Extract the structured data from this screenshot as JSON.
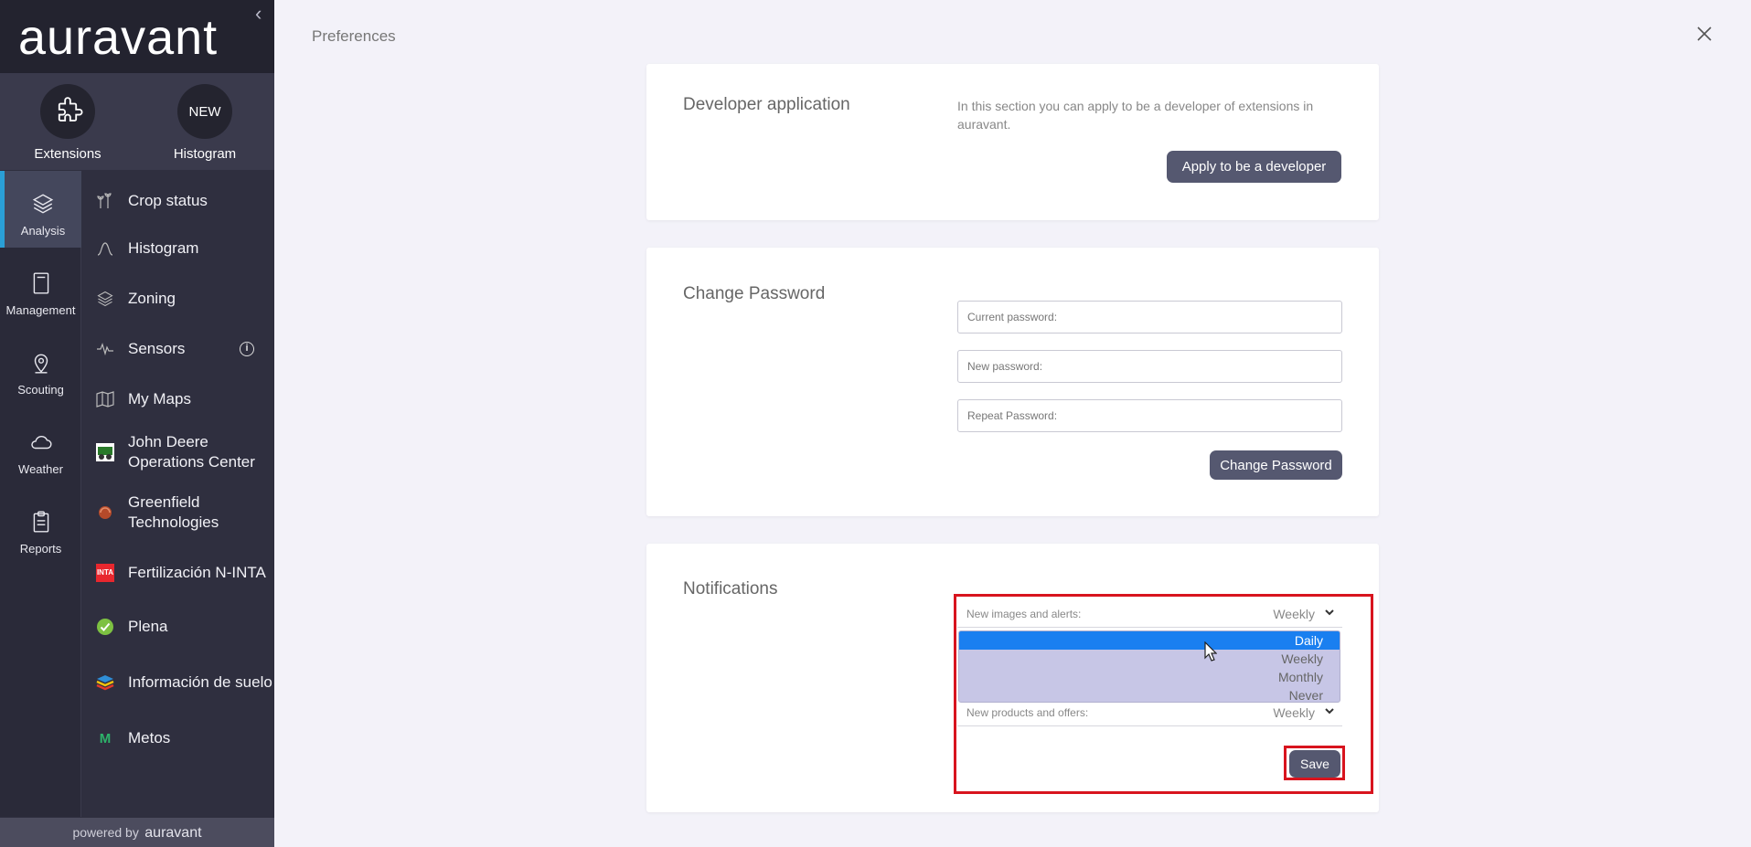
{
  "sidebar": {
    "brand": "auravant",
    "quick": [
      {
        "label": "Extensions",
        "icon": "puzzle-icon"
      },
      {
        "label": "Histogram",
        "badge": "NEW"
      }
    ],
    "rail": [
      {
        "label": "Analysis",
        "icon": "layers-icon",
        "active": true
      },
      {
        "label": "Management",
        "icon": "notebook-icon"
      },
      {
        "label": "Scouting",
        "icon": "pin-icon"
      },
      {
        "label": "Weather",
        "icon": "cloud-icon"
      },
      {
        "label": "Reports",
        "icon": "clipboard-icon"
      }
    ],
    "menu": [
      {
        "label": "Crop status",
        "icon": "crop-icon"
      },
      {
        "label": "Histogram",
        "icon": "curve-icon"
      },
      {
        "label": "Zoning",
        "icon": "layers-icon"
      },
      {
        "label": "Sensors",
        "icon": "pulse-icon",
        "info": "i"
      },
      {
        "label": "My Maps",
        "icon": "map-icon"
      },
      {
        "label": "John Deere Operations Center",
        "icon": "john-deere-icon"
      },
      {
        "label": "Greenfield Technologies",
        "icon": "greenfield-icon"
      },
      {
        "label": "Fertilización N-INTA",
        "icon": "inta-icon",
        "icon_text": "INTA"
      },
      {
        "label": "Plena",
        "icon": "plena-icon"
      },
      {
        "label": "Información de suelo",
        "icon": "soil-icon"
      },
      {
        "label": "Metos",
        "icon": "metos-icon",
        "icon_text": "M"
      }
    ],
    "powered_prefix": "powered by",
    "powered_brand": "auravant"
  },
  "header": {
    "title": "Preferences"
  },
  "developer": {
    "title": "Developer application",
    "description": "In this section you can apply to be a developer of extensions in auravant.",
    "button": "Apply to be a developer"
  },
  "password": {
    "title": "Change Password",
    "current_placeholder": "Current password:",
    "new_placeholder": "New password:",
    "repeat_placeholder": "Repeat Password:",
    "button": "Change Password"
  },
  "notifications": {
    "title": "Notifications",
    "images_label": "New images and alerts:",
    "images_value": "Weekly",
    "products_label": "New products and offers:",
    "products_value": "Weekly",
    "options": [
      "Daily",
      "Weekly",
      "Monthly",
      "Never"
    ],
    "highlighted_option": "Daily",
    "save": "Save"
  },
  "colors": {
    "sidebar_bg": "#2f2f3f",
    "accent": "#2a9fd6",
    "button": "#555870",
    "highlight": "#d8141e",
    "dropdown_selected": "#1a7ff0"
  }
}
